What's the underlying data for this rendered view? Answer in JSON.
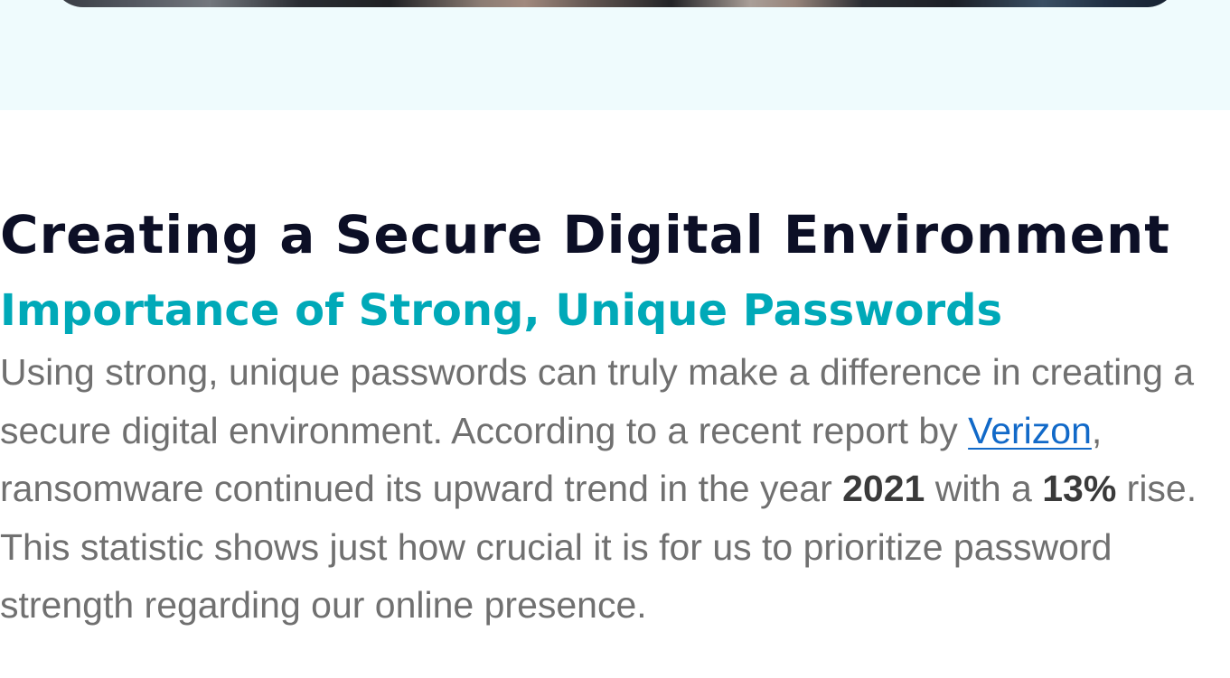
{
  "article": {
    "heading": "Creating a Secure Digital Environment",
    "subheading": "Importance of Strong, Unique Passwords",
    "paragraph": {
      "part1": "Using strong, unique passwords can truly make a difference in creating a secure digital environment. According to a recent report by ",
      "link_text": "Verizon",
      "part2": ", ransomware continued its upward trend in the year ",
      "year": "2021",
      "part3": " with a ",
      "percent": "13%",
      "part4": " rise. This statistic shows just how crucial it is for us to prioritize password strength regarding our online presence."
    }
  },
  "colors": {
    "hero_band": "#effbfd",
    "heading": "#0c0f26",
    "subheading": "#00a9b8",
    "body": "#707070",
    "link": "#1169c8"
  }
}
